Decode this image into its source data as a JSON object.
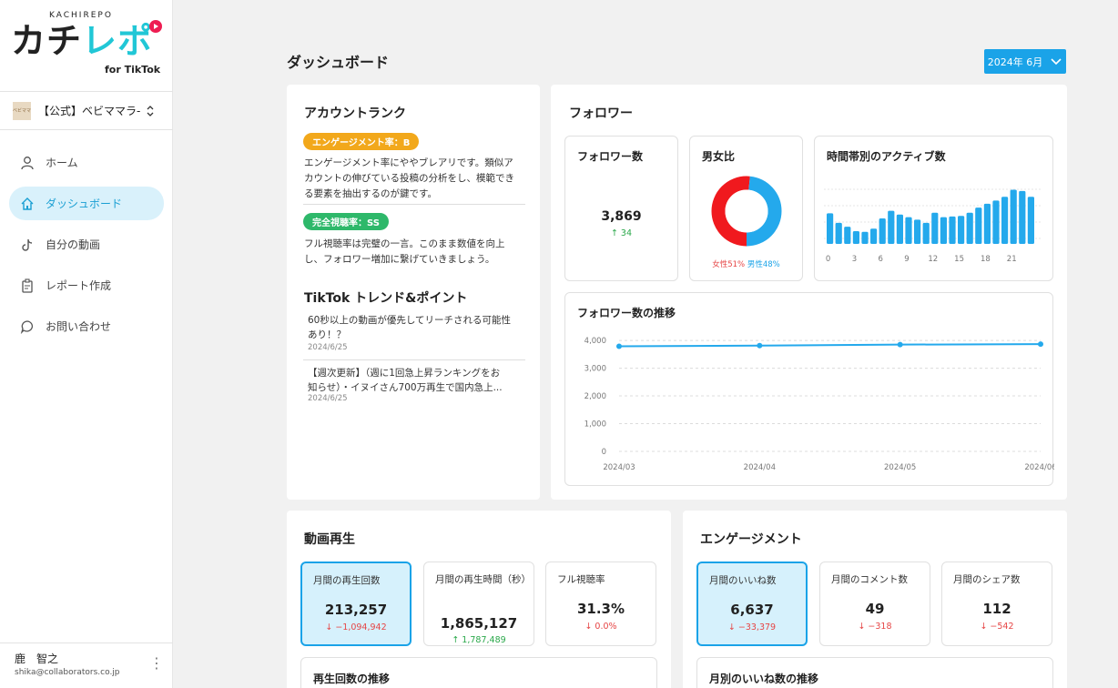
{
  "brand": {
    "small": "KACHIREPO",
    "main_a": "カチ",
    "main_b": "レポ",
    "sub": "for TikTok"
  },
  "account": {
    "thumb": "ベビママ",
    "name": "【公式】ベビママラ-",
    "caret": "⌃"
  },
  "nav": [
    {
      "label": "ホーム",
      "icon": "user-icon"
    },
    {
      "label": "ダッシュボード",
      "icon": "home-icon",
      "active": true
    },
    {
      "label": "自分の動画",
      "icon": "tiktok-icon"
    },
    {
      "label": "レポート作成",
      "icon": "clipboard-icon"
    },
    {
      "label": "お問い合わせ",
      "icon": "chat-bubble-icon"
    }
  ],
  "user": {
    "name": "鹿　智之",
    "email": "shika@collaborators.co.jp"
  },
  "page": {
    "title": "ダッシュボード",
    "month": "2024年 6月"
  },
  "rank": {
    "title": "アカウントランク",
    "badge1": "エンゲージメント率：B",
    "text1": [
      "エンゲージメント率にややブレアリです。類似ア",
      "カウントの伸びている投稿の分析をし、模範でき",
      "る要素を抽出するのが鍵です。"
    ],
    "badge2": "完全視聴率：SS",
    "text2": [
      "フル視聴率は完璧の一言。このまま数値を向上",
      "し、フォロワー増加に繋げていきましょう。"
    ],
    "trend_title": "TikTok トレンド&ポイント",
    "trends": [
      {
        "lines": [
          "60秒以上の動画が優先してリーチされる可能性",
          "あり！？"
        ],
        "date": "2024/6/25"
      },
      {
        "lines": [
          "【週次更新】（週に1回急上昇ランキングをお",
          "知らせ）・イヌイさん700万再生で国内急上..."
        ],
        "date": "2024/6/25"
      }
    ]
  },
  "follower": {
    "title": "フォロワー",
    "count_label": "フォロワー数",
    "count": "3,869",
    "count_delta": "↑ 34",
    "gender_label": "男女比",
    "female": "女性51%",
    "male": "男性48%",
    "active_label": "時間帯別のアクティブ数",
    "trend_label": "フォロワー数の推移"
  },
  "chart_data": [
    {
      "type": "pie",
      "labels": [
        "女性",
        "男性"
      ],
      "values": [
        51,
        48
      ],
      "colors": [
        "#f0191e",
        "#24a9ec"
      ]
    },
    {
      "type": "bar",
      "categories": [
        "0",
        "1",
        "2",
        "3",
        "4",
        "5",
        "6",
        "7",
        "8",
        "9",
        "10",
        "11",
        "12",
        "13",
        "14",
        "15",
        "16",
        "17",
        "18",
        "19",
        "20",
        "21",
        "22",
        "23"
      ],
      "tick_labels": [
        "0",
        "3",
        "6",
        "9",
        "12",
        "15",
        "18",
        "21"
      ],
      "values": [
        48,
        33,
        27,
        20,
        19,
        24,
        40,
        52,
        46,
        42,
        38,
        33,
        49,
        42,
        43,
        44,
        49,
        57,
        63,
        68,
        74,
        85,
        83,
        74
      ],
      "ylim": [
        0,
        100
      ],
      "color": "#24a9ec"
    },
    {
      "type": "line",
      "title": "フォロワー数の推移",
      "x": [
        "2024/03",
        "2024/04",
        "2024/05",
        "2024/06"
      ],
      "y": [
        3790,
        3815,
        3850,
        3869
      ],
      "yticks": [
        "0",
        "1,000",
        "2,000",
        "3,000",
        "4,000"
      ],
      "ylim": [
        0,
        4200
      ],
      "color": "#24a9ec"
    }
  ],
  "video": {
    "title": "動画再生",
    "metrics": [
      {
        "label": "月間の再生回数",
        "value": "213,257",
        "delta": "↓ −1,094,942",
        "dir": "down"
      },
      {
        "label": "月間の再生時間（秒）",
        "value": "1,865,127",
        "delta": "↑ 1,787,489",
        "dir": "up"
      },
      {
        "label": "フル視聴率",
        "value": "31.3%",
        "delta": "↓ 0.0%",
        "dir": "down"
      }
    ],
    "sub_title": "再生回数の推移"
  },
  "engage": {
    "title": "エンゲージメント",
    "metrics": [
      {
        "label": "月間のいいね数",
        "value": "6,637",
        "delta": "↓ −33,379",
        "dir": "down"
      },
      {
        "label": "月間のコメント数",
        "value": "49",
        "delta": "↓ −318",
        "dir": "down"
      },
      {
        "label": "月間のシェア数",
        "value": "112",
        "delta": "↓ −542",
        "dir": "down"
      }
    ],
    "sub_title": "月別のいいね数の推移"
  }
}
